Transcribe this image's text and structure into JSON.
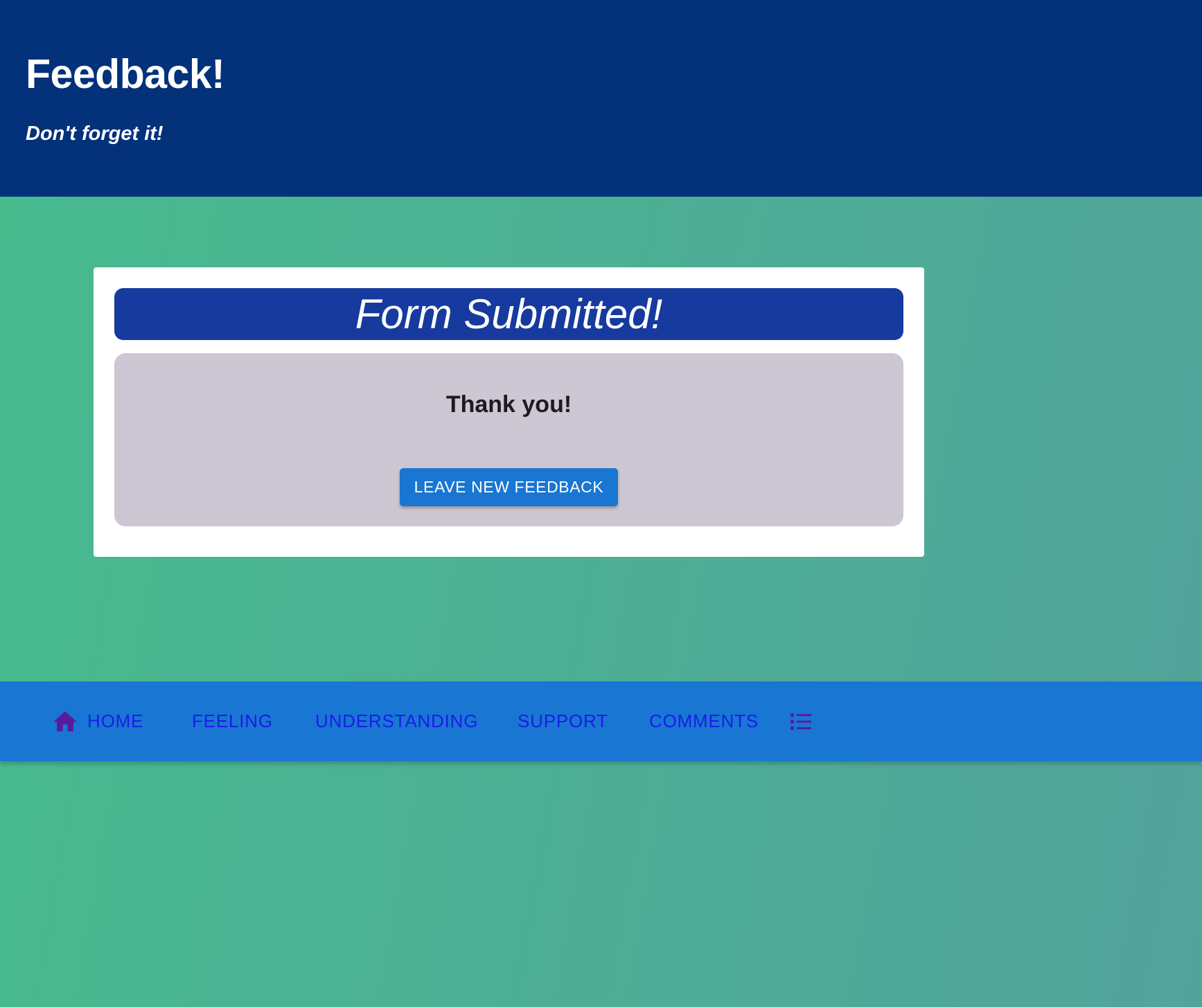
{
  "header": {
    "title": "Feedback!",
    "subtitle": "Don't forget it!"
  },
  "card": {
    "banner_title": "Form Submitted!",
    "thanks": "Thank you!",
    "button_label": "LEAVE NEW FEEDBACK"
  },
  "nav": {
    "home": "HOME",
    "feeling": "FEELING",
    "understanding": "UNDERSTANDING",
    "support": "SUPPORT",
    "comments": "COMMENTS",
    "home_icon": "home-icon",
    "list_icon": "list-icon"
  },
  "colors": {
    "header_bg": "#03317a",
    "banner_bg": "#173a9f",
    "card_body_bg": "#ccc7d2",
    "button_bg": "#1976d2",
    "nav_bg": "#1976d3",
    "nav_text": "#1a1cea",
    "nav_icon": "#5a1a9c",
    "page_gradient_start": "#47bb8e",
    "page_gradient_end": "#53a39c"
  }
}
